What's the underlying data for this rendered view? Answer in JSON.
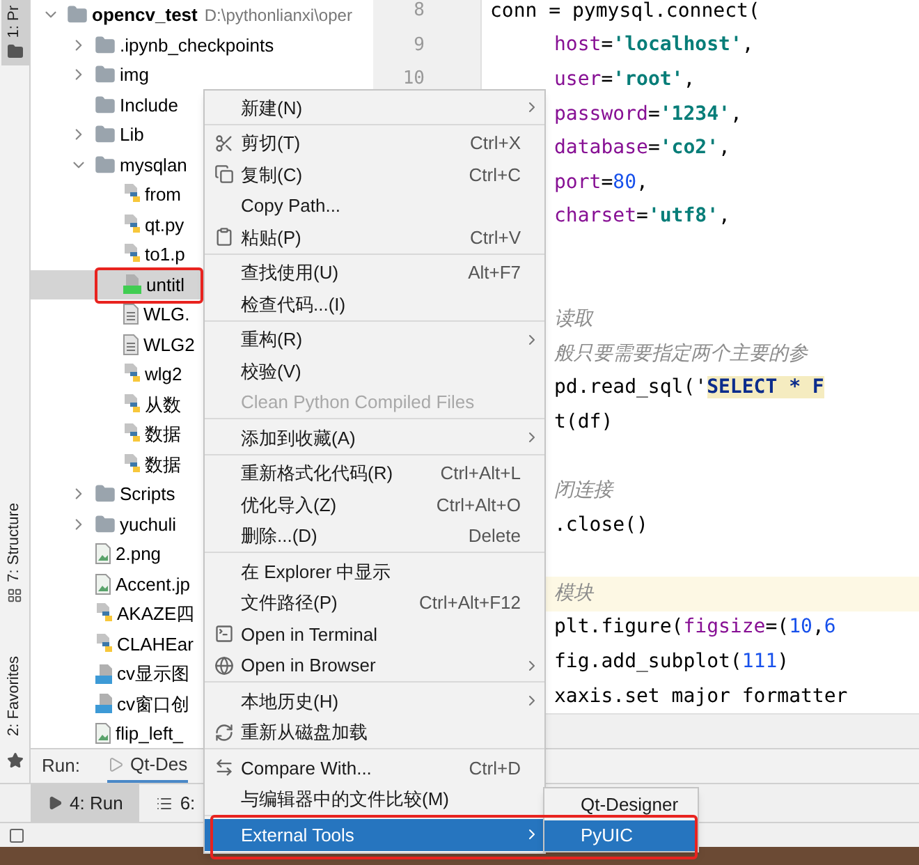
{
  "tool_strip": [
    {
      "label": "1: Pr",
      "selected": true
    },
    {
      "label": "7: Structure",
      "selected": false
    },
    {
      "label": "2: Favorites",
      "selected": false
    }
  ],
  "project": {
    "name": "opencv_test",
    "path": "D:\\pythonlianxi\\oper",
    "expanded": true,
    "children": [
      {
        "kind": "folder",
        "name": ".ipynb_checkpoints",
        "expanded": false,
        "selected": false,
        "marked": false
      },
      {
        "kind": "folder",
        "name": "img",
        "expanded": false,
        "selected": false,
        "marked": false
      },
      {
        "kind": "folder",
        "name": "Include",
        "selected": false,
        "marked": false
      },
      {
        "kind": "folder",
        "name": "Lib",
        "expanded": false,
        "selected": false,
        "marked": false
      },
      {
        "kind": "folder",
        "name": "mysqlan",
        "expanded": true,
        "selected": false,
        "marked": false,
        "children": [
          {
            "kind": "python",
            "name": "from",
            "selected": false,
            "marked": false
          },
          {
            "kind": "python",
            "name": "qt.py",
            "selected": false,
            "marked": false
          },
          {
            "kind": "python",
            "name": "to1.p",
            "selected": false,
            "marked": false
          },
          {
            "kind": "qt",
            "name": "untitl",
            "selected": true,
            "marked": true
          },
          {
            "kind": "text",
            "name": "WLG.",
            "selected": false,
            "marked": false
          },
          {
            "kind": "text",
            "name": "WLG2",
            "selected": false,
            "marked": false
          },
          {
            "kind": "python",
            "name": "wlg2",
            "selected": false,
            "marked": false
          },
          {
            "kind": "python",
            "name": "从数",
            "selected": false,
            "marked": false
          },
          {
            "kind": "python",
            "name": "数据",
            "selected": false,
            "marked": false
          },
          {
            "kind": "python",
            "name": "数据",
            "selected": false,
            "marked": false
          }
        ]
      },
      {
        "kind": "folder",
        "name": "Scripts",
        "expanded": false,
        "selected": false,
        "marked": false
      },
      {
        "kind": "folder",
        "name": "yuchuli",
        "expanded": false,
        "selected": false,
        "marked": false
      },
      {
        "kind": "image",
        "name": "2.png",
        "selected": false,
        "marked": false
      },
      {
        "kind": "image",
        "name": "Accent.jp",
        "selected": false,
        "marked": false
      },
      {
        "kind": "python",
        "name": "AKAZE四",
        "selected": false,
        "marked": false
      },
      {
        "kind": "python",
        "name": "CLAHEar",
        "selected": false,
        "marked": false
      },
      {
        "kind": "notebook",
        "name": "cv显示图",
        "selected": false,
        "marked": false
      },
      {
        "kind": "notebook",
        "name": "cv窗口创",
        "selected": false,
        "marked": false
      },
      {
        "kind": "image",
        "name": "flip_left_",
        "selected": false,
        "marked": false
      }
    ]
  },
  "line_numbers": [
    "8",
    "9",
    "10"
  ],
  "code_lines": [
    {
      "highlighted": false,
      "segments": [
        {
          "kind": "plain",
          "text": "conn = pymysql.connect("
        }
      ]
    },
    {
      "highlighted": false,
      "segments": [
        {
          "kind": "param",
          "text": "host"
        },
        {
          "kind": "plain",
          "text": "="
        },
        {
          "kind": "string",
          "text": "'localhost'"
        },
        {
          "kind": "plain",
          "text": ","
        }
      ]
    },
    {
      "highlighted": false,
      "segments": [
        {
          "kind": "param",
          "text": "user"
        },
        {
          "kind": "plain",
          "text": "="
        },
        {
          "kind": "string",
          "text": "'root'"
        },
        {
          "kind": "plain",
          "text": ","
        }
      ]
    },
    {
      "highlighted": false,
      "segments": [
        {
          "kind": "param",
          "text": "password"
        },
        {
          "kind": "plain",
          "text": "="
        },
        {
          "kind": "string",
          "text": "'1234'"
        },
        {
          "kind": "plain",
          "text": ","
        }
      ]
    },
    {
      "highlighted": false,
      "segments": [
        {
          "kind": "param",
          "text": "database"
        },
        {
          "kind": "plain",
          "text": "="
        },
        {
          "kind": "string",
          "text": "'co2'"
        },
        {
          "kind": "plain",
          "text": ","
        }
      ]
    },
    {
      "highlighted": false,
      "segments": [
        {
          "kind": "param",
          "text": "port"
        },
        {
          "kind": "plain",
          "text": "="
        },
        {
          "kind": "number",
          "text": "80"
        },
        {
          "kind": "plain",
          "text": ","
        }
      ]
    },
    {
      "highlighted": false,
      "segments": [
        {
          "kind": "param",
          "text": "charset"
        },
        {
          "kind": "plain",
          "text": "="
        },
        {
          "kind": "string",
          "text": "'utf8'"
        },
        {
          "kind": "plain",
          "text": ","
        }
      ]
    },
    {
      "highlighted": false
    },
    {
      "highlighted": false
    },
    {
      "highlighted": false,
      "segments": [
        {
          "kind": "comment",
          "text": "读取"
        }
      ]
    },
    {
      "highlighted": false,
      "segments": [
        {
          "kind": "comment",
          "text": "般只要需要指定两个主要的参"
        }
      ]
    },
    {
      "highlighted": false,
      "segments": [
        {
          "kind": "plain",
          "text": "pd.read_sql('"
        },
        {
          "kind": "sql",
          "text": "SELECT * F"
        }
      ]
    },
    {
      "highlighted": false,
      "segments": [
        {
          "kind": "plain",
          "text": "t(df)"
        }
      ]
    },
    {
      "highlighted": false
    },
    {
      "highlighted": false,
      "segments": [
        {
          "kind": "comment",
          "text": "闭连接"
        }
      ]
    },
    {
      "highlighted": false,
      "segments": [
        {
          "kind": "plain",
          "text": ".close()"
        }
      ]
    },
    {
      "highlighted": false
    },
    {
      "highlighted": true,
      "segments": [
        {
          "kind": "comment",
          "text": "模块"
        }
      ]
    },
    {
      "highlighted": false,
      "segments": [
        {
          "kind": "plain",
          "text": "plt.figure("
        },
        {
          "kind": "param",
          "text": "figsize"
        },
        {
          "kind": "plain",
          "text": "=("
        },
        {
          "kind": "number",
          "text": "10"
        },
        {
          "kind": "plain",
          "text": ","
        },
        {
          "kind": "number",
          "text": "6"
        }
      ]
    },
    {
      "highlighted": false,
      "segments": [
        {
          "kind": "plain",
          "text": "fig.add_subplot("
        },
        {
          "kind": "number",
          "text": "111"
        },
        {
          "kind": "plain",
          "text": ")"
        }
      ]
    },
    {
      "highlighted": false,
      "segments": [
        {
          "kind": "plain",
          "text": "xaxis.set major formatter"
        }
      ]
    }
  ],
  "run_panel": {
    "label": "Run:",
    "tab": "Qt-Des"
  },
  "bottom_tabs": [
    {
      "label": "4: Run",
      "selected": true
    },
    {
      "label": "6:",
      "selected": false
    }
  ],
  "context_menu": {
    "groups": [
      [
        {
          "label": "新建(N)",
          "has_submenu": true,
          "disabled": false,
          "selected": false,
          "marked": false
        }
      ],
      [
        {
          "label": "剪切(T)",
          "shortcut": "Ctrl+X",
          "has_submenu": false,
          "disabled": false,
          "selected": false,
          "marked": false
        },
        {
          "label": "复制(C)",
          "shortcut": "Ctrl+C",
          "has_submenu": false,
          "disabled": false,
          "selected": false,
          "marked": false
        },
        {
          "label": "Copy Path...",
          "has_submenu": false,
          "disabled": false,
          "selected": false,
          "marked": false
        },
        {
          "label": "粘贴(P)",
          "shortcut": "Ctrl+V",
          "has_submenu": false,
          "disabled": false,
          "selected": false,
          "marked": false
        }
      ],
      [
        {
          "label": "查找使用(U)",
          "shortcut": "Alt+F7",
          "has_submenu": false,
          "disabled": false,
          "selected": false,
          "marked": false
        },
        {
          "label": "检查代码...(I)",
          "has_submenu": false,
          "disabled": false,
          "selected": false,
          "marked": false
        }
      ],
      [
        {
          "label": "重构(R)",
          "has_submenu": true,
          "disabled": false,
          "selected": false,
          "marked": false
        },
        {
          "label": "校验(V)",
          "has_submenu": false,
          "disabled": false,
          "selected": false,
          "marked": false
        },
        {
          "label": "Clean Python Compiled Files",
          "has_submenu": false,
          "disabled": true,
          "selected": false,
          "marked": false
        }
      ],
      [
        {
          "label": "添加到收藏(A)",
          "has_submenu": true,
          "disabled": false,
          "selected": false,
          "marked": false
        }
      ],
      [
        {
          "label": "重新格式化代码(R)",
          "shortcut": "Ctrl+Alt+L",
          "has_submenu": false,
          "disabled": false,
          "selected": false,
          "marked": false
        },
        {
          "label": "优化导入(Z)",
          "shortcut": "Ctrl+Alt+O",
          "has_submenu": false,
          "disabled": false,
          "selected": false,
          "marked": false
        },
        {
          "label": "删除...(D)",
          "shortcut": "Delete",
          "has_submenu": false,
          "disabled": false,
          "selected": false,
          "marked": false
        }
      ],
      [
        {
          "label": "在 Explorer 中显示",
          "has_submenu": false,
          "disabled": false,
          "selected": false,
          "marked": false
        },
        {
          "label": "文件路径(P)",
          "shortcut": "Ctrl+Alt+F12",
          "has_submenu": false,
          "disabled": false,
          "selected": false,
          "marked": false
        },
        {
          "label": "Open in Terminal",
          "has_submenu": false,
          "disabled": false,
          "selected": false,
          "marked": false
        },
        {
          "label": "Open in Browser",
          "has_submenu": true,
          "disabled": false,
          "selected": false,
          "marked": false
        }
      ],
      [
        {
          "label": "本地历史(H)",
          "has_submenu": true,
          "disabled": false,
          "selected": false,
          "marked": false
        },
        {
          "label": "重新从磁盘加载",
          "has_submenu": false,
          "disabled": false,
          "selected": false,
          "marked": false
        }
      ],
      [
        {
          "label": "Compare With...",
          "shortcut": "Ctrl+D",
          "has_submenu": false,
          "disabled": false,
          "selected": false,
          "marked": false
        },
        {
          "label": "与编辑器中的文件比较(M)",
          "has_submenu": false,
          "disabled": false,
          "selected": false,
          "marked": false
        }
      ],
      [
        {
          "label": "External Tools",
          "has_submenu": true,
          "disabled": false,
          "selected": true,
          "marked": true
        }
      ]
    ]
  },
  "submenu": [
    {
      "label": "Qt-Designer",
      "selected": false
    },
    {
      "label": "PyUIC",
      "selected": true
    }
  ]
}
